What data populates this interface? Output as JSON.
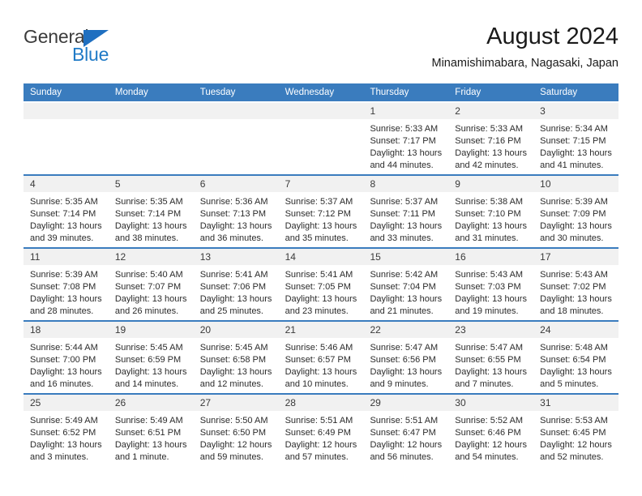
{
  "brand": {
    "name_top": "General",
    "name_bottom": "Blue",
    "color_dark": "#3b3b3b",
    "color_blue": "#1f7ac6"
  },
  "header": {
    "title": "August 2024",
    "subtitle": "Minamishimabara, Nagasaki, Japan"
  },
  "theme": {
    "header_bg": "#3a7cbe",
    "day_strip_bg": "#f1f1f1",
    "text": "#2b2b2b"
  },
  "weekdays": [
    "Sunday",
    "Monday",
    "Tuesday",
    "Wednesday",
    "Thursday",
    "Friday",
    "Saturday"
  ],
  "weeks": [
    [
      {
        "day": ""
      },
      {
        "day": ""
      },
      {
        "day": ""
      },
      {
        "day": ""
      },
      {
        "day": "1",
        "sunrise": "Sunrise: 5:33 AM",
        "sunset": "Sunset: 7:17 PM",
        "daylight": "Daylight: 13 hours and 44 minutes."
      },
      {
        "day": "2",
        "sunrise": "Sunrise: 5:33 AM",
        "sunset": "Sunset: 7:16 PM",
        "daylight": "Daylight: 13 hours and 42 minutes."
      },
      {
        "day": "3",
        "sunrise": "Sunrise: 5:34 AM",
        "sunset": "Sunset: 7:15 PM",
        "daylight": "Daylight: 13 hours and 41 minutes."
      }
    ],
    [
      {
        "day": "4",
        "sunrise": "Sunrise: 5:35 AM",
        "sunset": "Sunset: 7:14 PM",
        "daylight": "Daylight: 13 hours and 39 minutes."
      },
      {
        "day": "5",
        "sunrise": "Sunrise: 5:35 AM",
        "sunset": "Sunset: 7:14 PM",
        "daylight": "Daylight: 13 hours and 38 minutes."
      },
      {
        "day": "6",
        "sunrise": "Sunrise: 5:36 AM",
        "sunset": "Sunset: 7:13 PM",
        "daylight": "Daylight: 13 hours and 36 minutes."
      },
      {
        "day": "7",
        "sunrise": "Sunrise: 5:37 AM",
        "sunset": "Sunset: 7:12 PM",
        "daylight": "Daylight: 13 hours and 35 minutes."
      },
      {
        "day": "8",
        "sunrise": "Sunrise: 5:37 AM",
        "sunset": "Sunset: 7:11 PM",
        "daylight": "Daylight: 13 hours and 33 minutes."
      },
      {
        "day": "9",
        "sunrise": "Sunrise: 5:38 AM",
        "sunset": "Sunset: 7:10 PM",
        "daylight": "Daylight: 13 hours and 31 minutes."
      },
      {
        "day": "10",
        "sunrise": "Sunrise: 5:39 AM",
        "sunset": "Sunset: 7:09 PM",
        "daylight": "Daylight: 13 hours and 30 minutes."
      }
    ],
    [
      {
        "day": "11",
        "sunrise": "Sunrise: 5:39 AM",
        "sunset": "Sunset: 7:08 PM",
        "daylight": "Daylight: 13 hours and 28 minutes."
      },
      {
        "day": "12",
        "sunrise": "Sunrise: 5:40 AM",
        "sunset": "Sunset: 7:07 PM",
        "daylight": "Daylight: 13 hours and 26 minutes."
      },
      {
        "day": "13",
        "sunrise": "Sunrise: 5:41 AM",
        "sunset": "Sunset: 7:06 PM",
        "daylight": "Daylight: 13 hours and 25 minutes."
      },
      {
        "day": "14",
        "sunrise": "Sunrise: 5:41 AM",
        "sunset": "Sunset: 7:05 PM",
        "daylight": "Daylight: 13 hours and 23 minutes."
      },
      {
        "day": "15",
        "sunrise": "Sunrise: 5:42 AM",
        "sunset": "Sunset: 7:04 PM",
        "daylight": "Daylight: 13 hours and 21 minutes."
      },
      {
        "day": "16",
        "sunrise": "Sunrise: 5:43 AM",
        "sunset": "Sunset: 7:03 PM",
        "daylight": "Daylight: 13 hours and 19 minutes."
      },
      {
        "day": "17",
        "sunrise": "Sunrise: 5:43 AM",
        "sunset": "Sunset: 7:02 PM",
        "daylight": "Daylight: 13 hours and 18 minutes."
      }
    ],
    [
      {
        "day": "18",
        "sunrise": "Sunrise: 5:44 AM",
        "sunset": "Sunset: 7:00 PM",
        "daylight": "Daylight: 13 hours and 16 minutes."
      },
      {
        "day": "19",
        "sunrise": "Sunrise: 5:45 AM",
        "sunset": "Sunset: 6:59 PM",
        "daylight": "Daylight: 13 hours and 14 minutes."
      },
      {
        "day": "20",
        "sunrise": "Sunrise: 5:45 AM",
        "sunset": "Sunset: 6:58 PM",
        "daylight": "Daylight: 13 hours and 12 minutes."
      },
      {
        "day": "21",
        "sunrise": "Sunrise: 5:46 AM",
        "sunset": "Sunset: 6:57 PM",
        "daylight": "Daylight: 13 hours and 10 minutes."
      },
      {
        "day": "22",
        "sunrise": "Sunrise: 5:47 AM",
        "sunset": "Sunset: 6:56 PM",
        "daylight": "Daylight: 13 hours and 9 minutes."
      },
      {
        "day": "23",
        "sunrise": "Sunrise: 5:47 AM",
        "sunset": "Sunset: 6:55 PM",
        "daylight": "Daylight: 13 hours and 7 minutes."
      },
      {
        "day": "24",
        "sunrise": "Sunrise: 5:48 AM",
        "sunset": "Sunset: 6:54 PM",
        "daylight": "Daylight: 13 hours and 5 minutes."
      }
    ],
    [
      {
        "day": "25",
        "sunrise": "Sunrise: 5:49 AM",
        "sunset": "Sunset: 6:52 PM",
        "daylight": "Daylight: 13 hours and 3 minutes."
      },
      {
        "day": "26",
        "sunrise": "Sunrise: 5:49 AM",
        "sunset": "Sunset: 6:51 PM",
        "daylight": "Daylight: 13 hours and 1 minute."
      },
      {
        "day": "27",
        "sunrise": "Sunrise: 5:50 AM",
        "sunset": "Sunset: 6:50 PM",
        "daylight": "Daylight: 12 hours and 59 minutes."
      },
      {
        "day": "28",
        "sunrise": "Sunrise: 5:51 AM",
        "sunset": "Sunset: 6:49 PM",
        "daylight": "Daylight: 12 hours and 57 minutes."
      },
      {
        "day": "29",
        "sunrise": "Sunrise: 5:51 AM",
        "sunset": "Sunset: 6:47 PM",
        "daylight": "Daylight: 12 hours and 56 minutes."
      },
      {
        "day": "30",
        "sunrise": "Sunrise: 5:52 AM",
        "sunset": "Sunset: 6:46 PM",
        "daylight": "Daylight: 12 hours and 54 minutes."
      },
      {
        "day": "31",
        "sunrise": "Sunrise: 5:53 AM",
        "sunset": "Sunset: 6:45 PM",
        "daylight": "Daylight: 12 hours and 52 minutes."
      }
    ]
  ]
}
